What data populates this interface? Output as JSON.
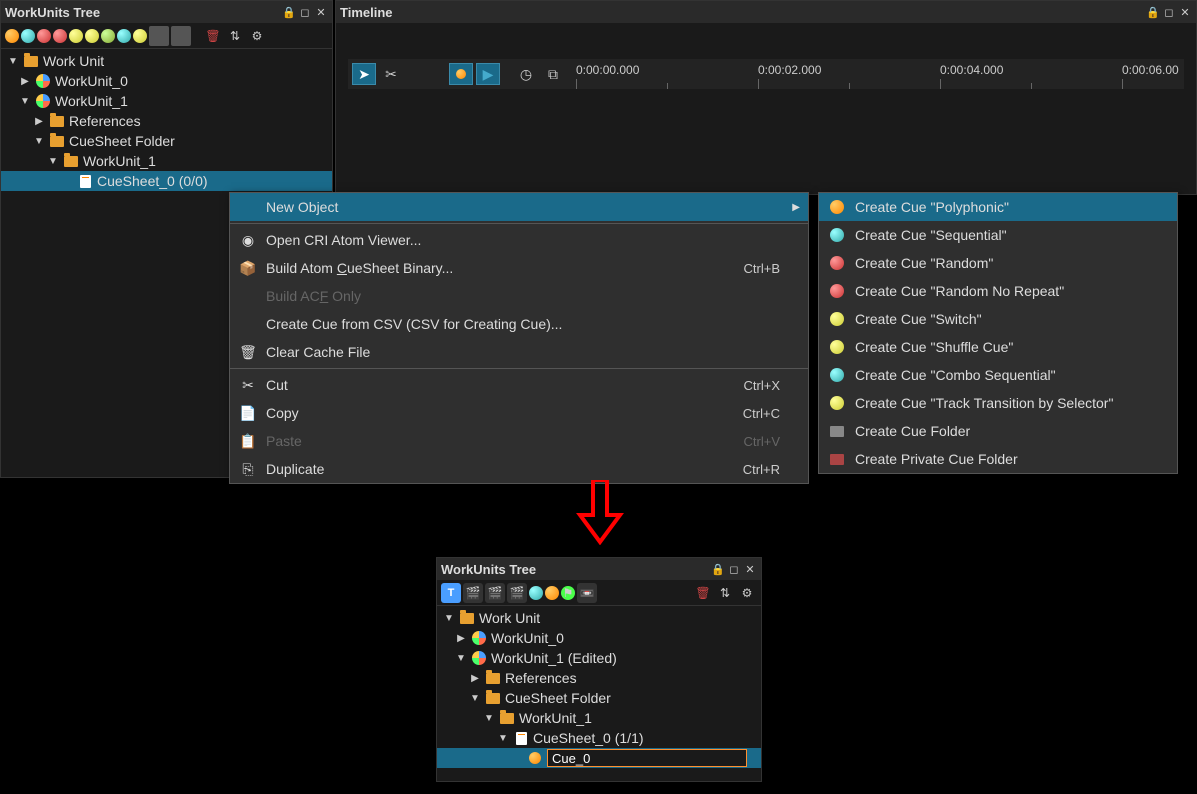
{
  "panel1": {
    "title": "WorkUnits Tree",
    "tree": [
      {
        "label": "Work Unit",
        "indent": 0,
        "arrow": "down",
        "icon": "folder"
      },
      {
        "label": "WorkUnit_0",
        "indent": 1,
        "arrow": "right",
        "icon": "work"
      },
      {
        "label": "WorkUnit_1",
        "indent": 1,
        "arrow": "down",
        "icon": "work"
      },
      {
        "label": "References",
        "indent": 2,
        "arrow": "right",
        "icon": "folder"
      },
      {
        "label": "CueSheet Folder",
        "indent": 2,
        "arrow": "down",
        "icon": "folder"
      },
      {
        "label": "WorkUnit_1",
        "indent": 3,
        "arrow": "down",
        "icon": "folder"
      },
      {
        "label": "CueSheet_0 (0/0)",
        "indent": 4,
        "arrow": "",
        "icon": "doc",
        "selected": true
      }
    ]
  },
  "timeline": {
    "title": "Timeline",
    "times": [
      "0:00:00.000",
      "0:00:02.000",
      "0:00:04.000",
      "0:00:06.00"
    ]
  },
  "contextMenu": {
    "items": [
      {
        "label": "New Object",
        "highlight": true,
        "arrow": true
      },
      {
        "sep": true
      },
      {
        "label": "Open CRI Atom Viewer...",
        "icon": "viewer"
      },
      {
        "label": "Build Atom CueSheet Binary...",
        "icon": "build",
        "shortcut": "Ctrl+B",
        "underline": "C"
      },
      {
        "label": "Build ACF Only",
        "disabled": true,
        "underline": "F"
      },
      {
        "label": "Create Cue from CSV (CSV for Creating Cue)..."
      },
      {
        "label": "Clear Cache File",
        "icon": "trash"
      },
      {
        "sep": true
      },
      {
        "label": "Cut",
        "icon": "cut",
        "shortcut": "Ctrl+X"
      },
      {
        "label": "Copy",
        "icon": "copy",
        "shortcut": "Ctrl+C"
      },
      {
        "label": "Paste",
        "icon": "paste",
        "shortcut": "Ctrl+V",
        "disabled": true
      },
      {
        "label": "Duplicate",
        "icon": "dup",
        "shortcut": "Ctrl+R"
      }
    ]
  },
  "submenu": {
    "items": [
      {
        "label": "Create Cue \"Polyphonic\"",
        "highlight": true,
        "icon": "orange"
      },
      {
        "label": "Create Cue \"Sequential\"",
        "icon": "cyan"
      },
      {
        "label": "Create Cue \"Random\"",
        "icon": "red"
      },
      {
        "label": "Create Cue \"Random No Repeat\"",
        "icon": "red"
      },
      {
        "label": "Create Cue \"Switch\"",
        "icon": "yellow"
      },
      {
        "label": "Create Cue \"Shuffle Cue\"",
        "icon": "yellow"
      },
      {
        "label": "Create Cue \"Combo Sequential\"",
        "icon": "cyan"
      },
      {
        "label": "Create Cue \"Track Transition by Selector\"",
        "icon": "yellow"
      },
      {
        "label": "Create Cue Folder",
        "icon": "folder"
      },
      {
        "label": "Create Private Cue Folder",
        "icon": "folder-red"
      }
    ]
  },
  "panel2": {
    "title": "WorkUnits Tree",
    "tree": [
      {
        "label": "Work Unit",
        "indent": 0,
        "arrow": "down",
        "icon": "folder"
      },
      {
        "label": "WorkUnit_0",
        "indent": 1,
        "arrow": "right",
        "icon": "work"
      },
      {
        "label": "WorkUnit_1 (Edited)",
        "indent": 1,
        "arrow": "down",
        "icon": "work"
      },
      {
        "label": "References",
        "indent": 2,
        "arrow": "right",
        "icon": "folder"
      },
      {
        "label": "CueSheet Folder",
        "indent": 2,
        "arrow": "down",
        "icon": "folder"
      },
      {
        "label": "WorkUnit_1",
        "indent": 3,
        "arrow": "down",
        "icon": "folder"
      },
      {
        "label": "CueSheet_0 (1/1)",
        "indent": 4,
        "arrow": "down",
        "icon": "doc"
      },
      {
        "label": "Cue_0",
        "indent": 5,
        "arrow": "",
        "icon": "orange-ball",
        "selected": true,
        "editing": true
      }
    ],
    "editValue": "Cue_0"
  }
}
